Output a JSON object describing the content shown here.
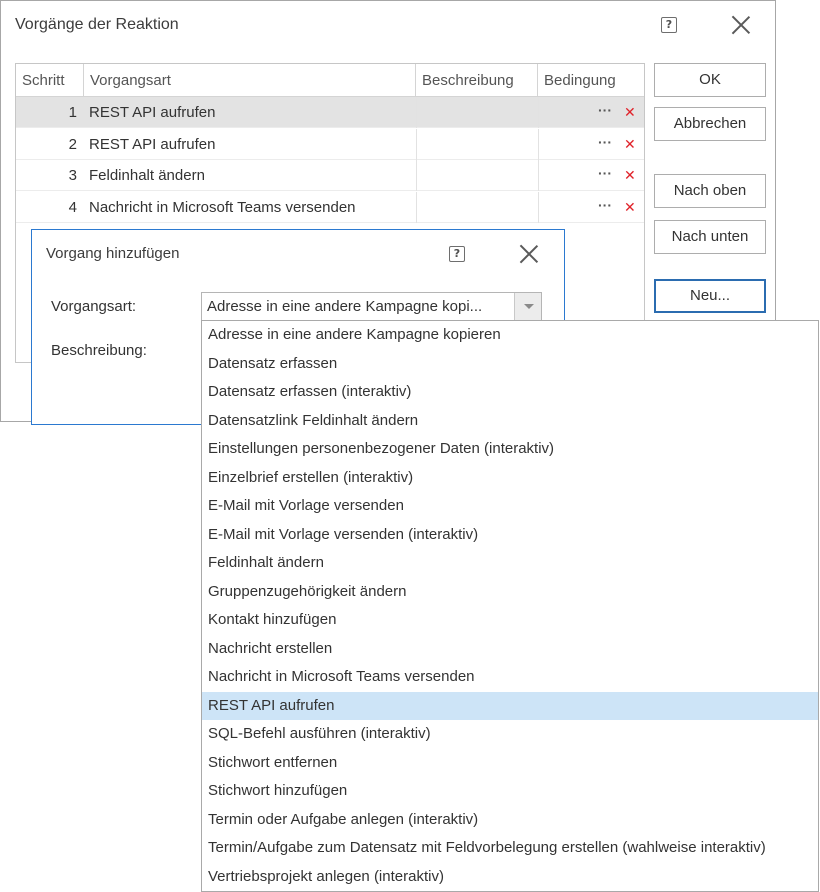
{
  "main_dialog": {
    "title": "Vorgänge der Reaktion",
    "grid": {
      "columns": [
        "Schritt",
        "Vorgangsart",
        "Beschreibung",
        "Bedingung"
      ],
      "rows": [
        {
          "step": "1",
          "type": "REST API aufrufen",
          "description": "",
          "condition_more": "···",
          "condition_delete": "✕"
        },
        {
          "step": "2",
          "type": "REST API aufrufen",
          "description": "",
          "condition_more": "···",
          "condition_delete": "✕"
        },
        {
          "step": "3",
          "type": "Feldinhalt ändern",
          "description": "",
          "condition_more": "···",
          "condition_delete": "✕"
        },
        {
          "step": "4",
          "type": "Nachricht in Microsoft Teams versenden",
          "description": "",
          "condition_more": "···",
          "condition_delete": "✕"
        }
      ]
    },
    "buttons": {
      "ok": "OK",
      "cancel": "Abbrechen",
      "up": "Nach oben",
      "down": "Nach unten",
      "new": "Neu..."
    }
  },
  "sub_dialog": {
    "title": "Vorgang hinzufügen",
    "type_label": "Vorgangsart:",
    "description_label": "Beschreibung:",
    "combo_value": "Adresse in eine andere Kampagne kopi..."
  },
  "dropdown": {
    "highlighted_index": 13,
    "options": [
      "Adresse in eine andere Kampagne kopieren",
      "Datensatz erfassen",
      "Datensatz erfassen (interaktiv)",
      "Datensatzlink Feldinhalt ändern",
      "Einstellungen personenbezogener Daten (interaktiv)",
      "Einzelbrief erstellen (interaktiv)",
      "E-Mail mit Vorlage versenden",
      "E-Mail mit Vorlage versenden (interaktiv)",
      "Feldinhalt ändern",
      "Gruppenzugehörigkeit ändern",
      "Kontakt hinzufügen",
      "Nachricht erstellen",
      "Nachricht in Microsoft Teams versenden",
      "REST API aufrufen",
      "SQL-Befehl ausführen (interaktiv)",
      "Stichwort entfernen",
      "Stichwort hinzufügen",
      "Termin oder Aufgabe anlegen (interaktiv)",
      "Termin/Aufgabe zum Datensatz mit Feldvorbelegung erstellen (wahlweise interaktiv)",
      "Vertriebsprojekt anlegen (interaktiv)"
    ]
  },
  "colors": {
    "accent": "#2b79d0",
    "highlight": "#cde4f7",
    "delete": "#e0222a",
    "selected_row": "#e3e3e3"
  },
  "icons": {
    "help": "help-icon",
    "close": "close-icon",
    "more": "more-dots-icon",
    "delete": "delete-x-icon",
    "dropdown": "chevron-down-icon"
  }
}
